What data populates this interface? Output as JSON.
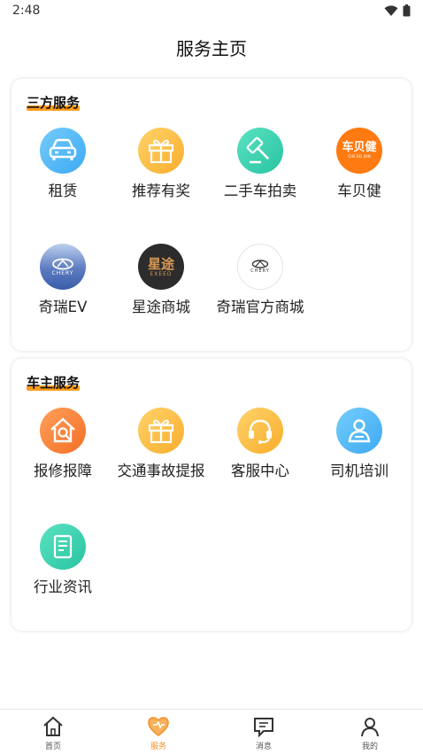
{
  "status_bar": {
    "time": "2:48"
  },
  "header": {
    "title": "服务主页"
  },
  "sections": [
    {
      "title": "三方服务",
      "items": [
        {
          "label": "租赁",
          "icon": "car-icon"
        },
        {
          "label": "推荐有奖",
          "icon": "gift-icon"
        },
        {
          "label": "二手车拍卖",
          "icon": "gavel-icon"
        },
        {
          "label": "车贝健",
          "icon": "chebeijian-logo",
          "logo_text": "车贝健",
          "logo_subtext": "CHE BEI JIAN"
        },
        {
          "label": "奇瑞EV",
          "icon": "chery-ev-logo",
          "logo_text": "CHERY"
        },
        {
          "label": "星途商城",
          "icon": "exeed-logo",
          "logo_text": "星途",
          "logo_subtext": "EXEED"
        },
        {
          "label": "奇瑞官方商城",
          "icon": "chery-official-logo",
          "logo_text": "CHERY"
        }
      ]
    },
    {
      "title": "车主服务",
      "items": [
        {
          "label": "报修报障",
          "icon": "repair-icon"
        },
        {
          "label": "交通事故提报",
          "icon": "gift-icon"
        },
        {
          "label": "客服中心",
          "icon": "headset-icon"
        },
        {
          "label": "司机培训",
          "icon": "driver-icon"
        },
        {
          "label": "行业资讯",
          "icon": "news-icon"
        }
      ]
    }
  ],
  "bottom_nav": [
    {
      "label": "首页",
      "icon": "home-icon",
      "active": false
    },
    {
      "label": "服务",
      "icon": "heart-icon",
      "active": true
    },
    {
      "label": "消息",
      "icon": "message-icon",
      "active": false
    },
    {
      "label": "我的",
      "icon": "person-icon",
      "active": false
    }
  ],
  "colors": {
    "accent": "#f5922b",
    "underline": "#ff9b1a"
  }
}
